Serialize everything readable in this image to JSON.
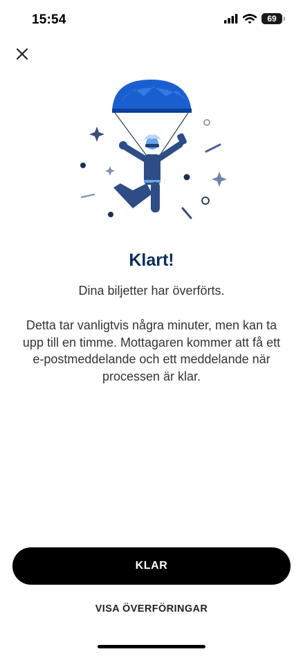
{
  "status_bar": {
    "time": "15:54",
    "battery": "69"
  },
  "icons": {
    "close": "close-icon",
    "signal": "cellular-signal-icon",
    "wifi": "wifi-icon",
    "battery": "battery-icon",
    "illustration": "parachute-illustration"
  },
  "content": {
    "title": "Klart!",
    "subtitle": "Dina biljetter har överförts.",
    "body": "Detta tar vanligtvis några minuter, men kan ta upp till en timme. Mottagaren kommer att få ett e-postmeddelande och ett meddelande när processen är klar."
  },
  "actions": {
    "primary_label": "KLAR",
    "secondary_label": "VISA ÖVERFÖRINGAR"
  },
  "colors": {
    "title": "#0b2d5b",
    "primary_button_bg": "#000000",
    "canopy": "#1a5fd0",
    "figure": "#2e4c86"
  }
}
